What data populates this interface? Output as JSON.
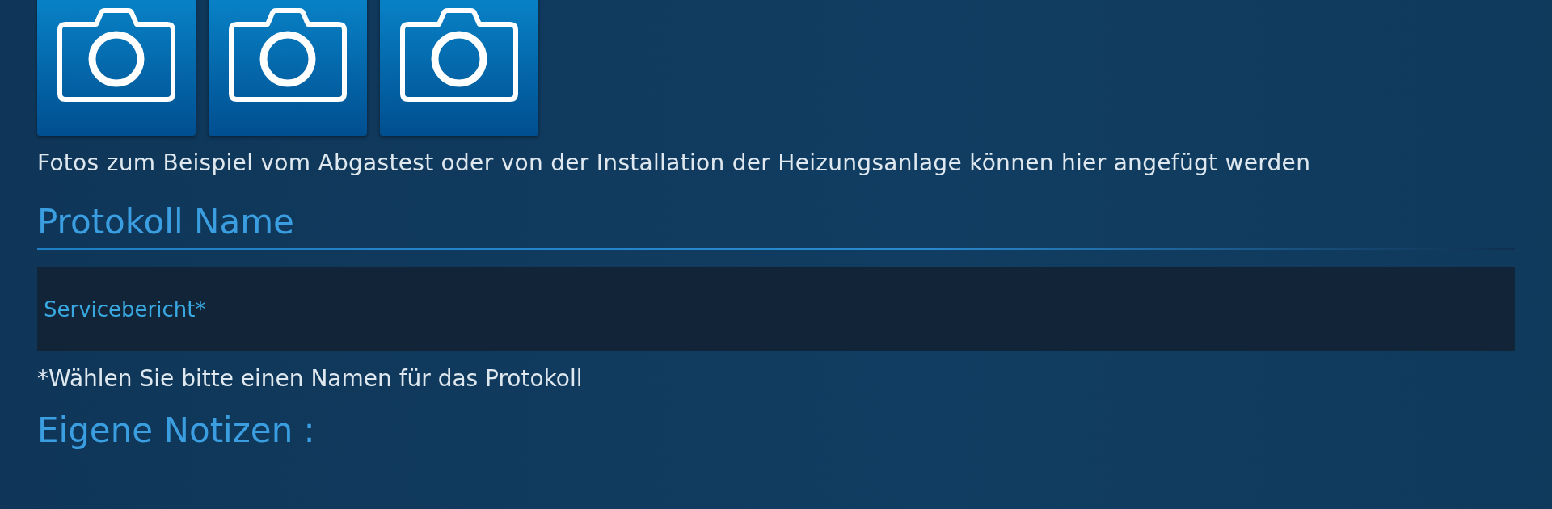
{
  "photo_buttons": [
    {
      "kind": "camera"
    },
    {
      "kind": "camera"
    },
    {
      "kind": "camera"
    }
  ],
  "photo_hint": "Fotos zum Beispiel vom Abgastest oder von der Installation der Heizungsanlage können hier angefügt werden",
  "protocol_name": {
    "heading": "Protokoll Name",
    "placeholder": "Servicebericht*",
    "hint": "*Wählen Sie bitte einen Namen für das Protokoll"
  },
  "notes": {
    "heading": "Eigene Notizen :"
  }
}
